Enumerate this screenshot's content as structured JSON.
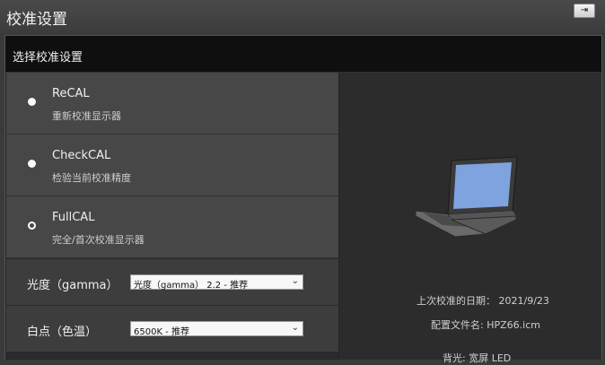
{
  "window": {
    "title": "校准设置",
    "pin_button": "⇥"
  },
  "section": {
    "title": "选择校准设置"
  },
  "options": [
    {
      "name": "ReCAL",
      "desc": "重新校准显示器",
      "selected": false
    },
    {
      "name": "CheckCAL",
      "desc": "检验当前校准精度",
      "selected": false
    },
    {
      "name": "FullCAL",
      "desc": "完全/首次校准显示器",
      "selected": true
    }
  ],
  "settings": {
    "gamma": {
      "label": "光度（gamma）",
      "value": "光度（gamma） 2.2 - 推荐"
    },
    "whitepoint": {
      "label": "白点（色温）",
      "value": "6500K - 推荐"
    }
  },
  "info": {
    "last_cal": "上次校准的日期： 2021/9/23",
    "profile": "配置文件名: HPZ66.icm",
    "backlight": "背光: 宽屏 LED"
  },
  "colors": {
    "screen": "#7fa3de",
    "option_bg": "#474747",
    "header_bg": "#0f0f0f"
  }
}
